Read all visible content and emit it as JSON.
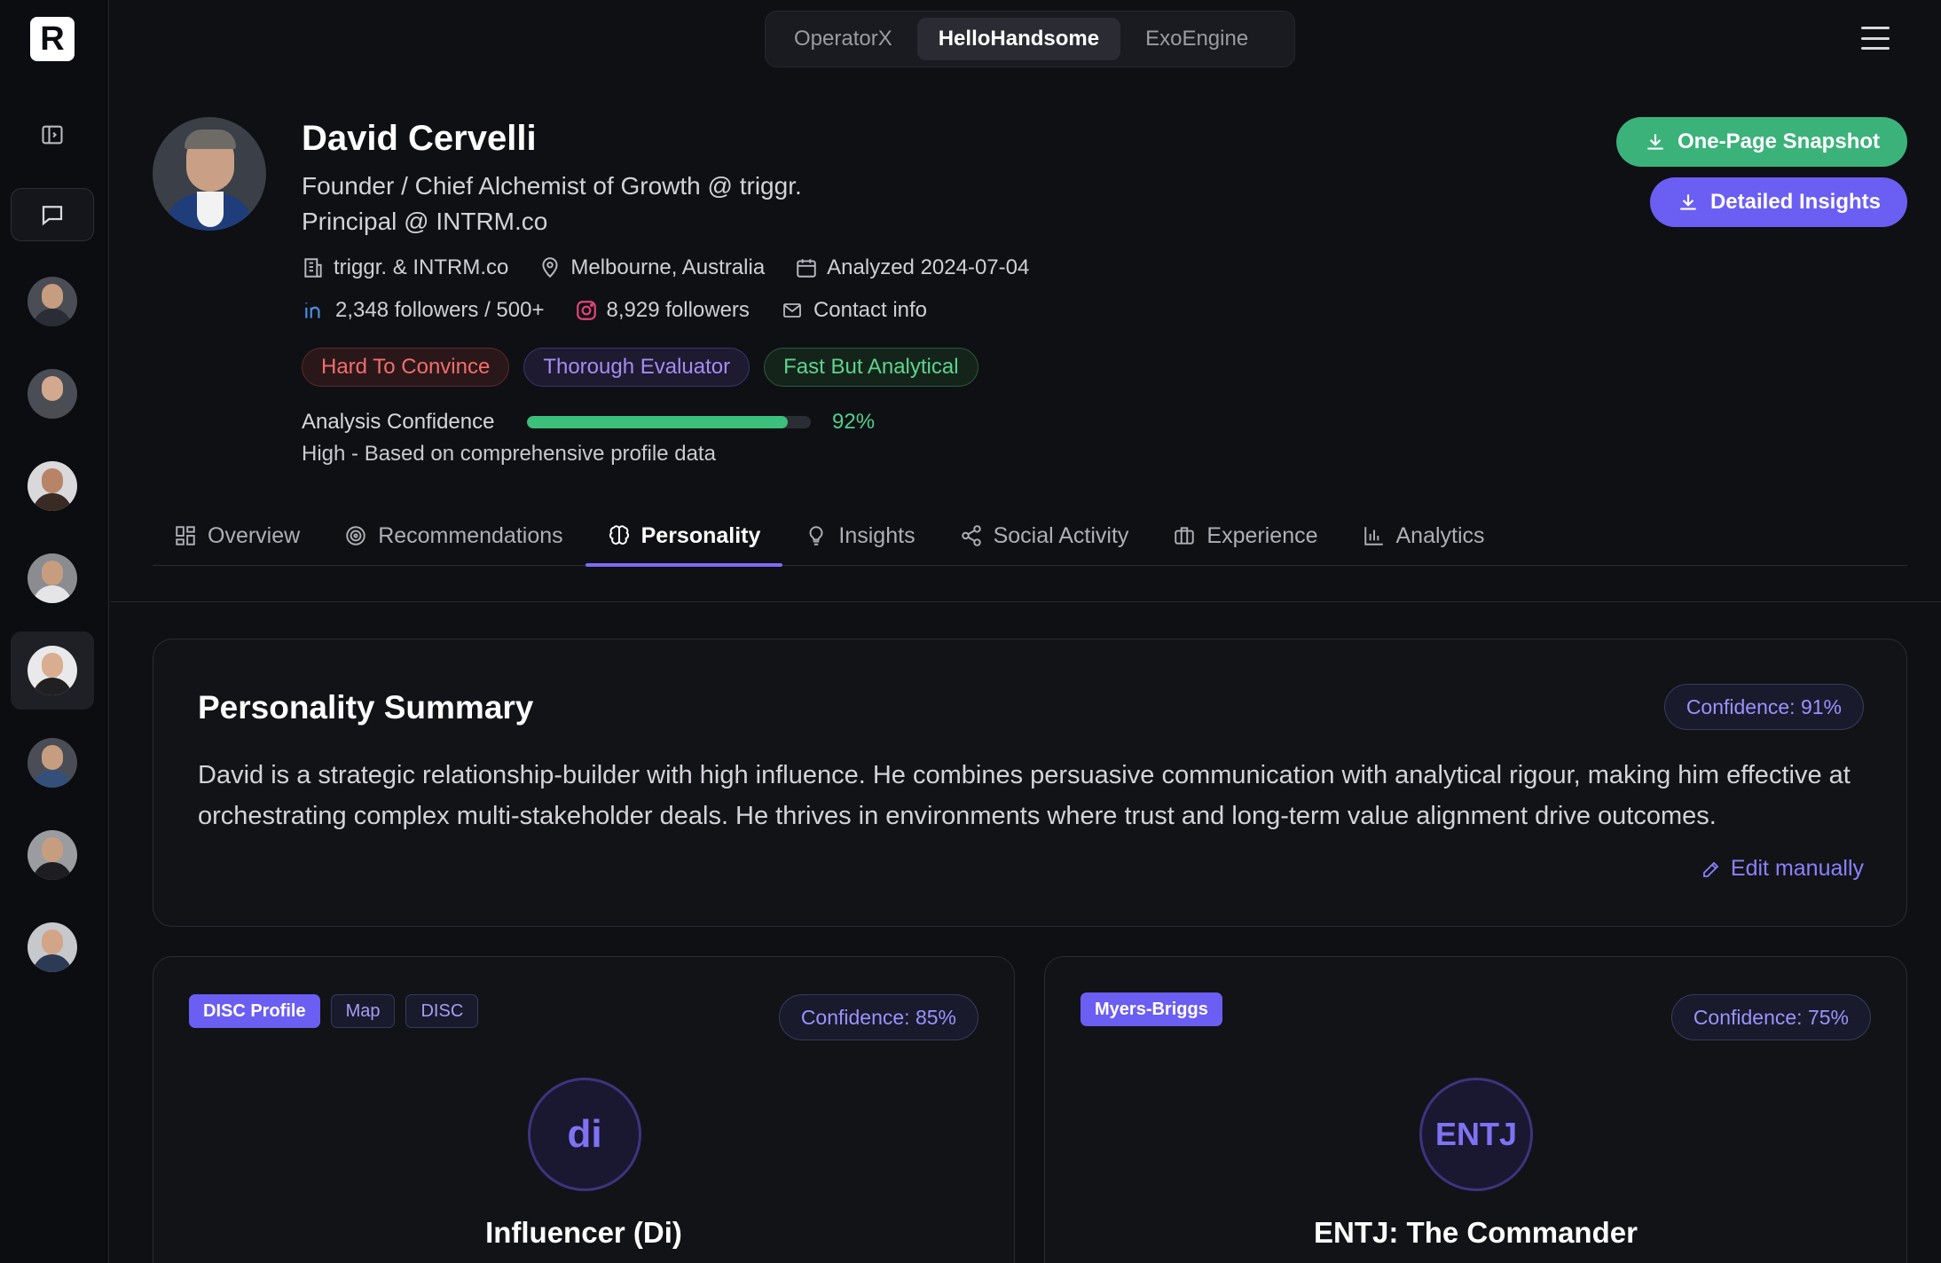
{
  "app": {
    "logo_letter": "R"
  },
  "workspace_switcher": {
    "items": [
      "OperatorX",
      "HelloHandsome",
      "ExoEngine"
    ],
    "active": "HelloHandsome"
  },
  "profile": {
    "name": "David Cervelli",
    "headline_1": "Founder / Chief Alchemist of Growth @ triggr.",
    "headline_2": "Principal @ INTRM.co",
    "company": "triggr. & INTRM.co",
    "location": "Melbourne, Australia",
    "analyzed": "Analyzed 2024-07-04",
    "linkedin": "2,348 followers / 500+",
    "instagram": "8,929 followers",
    "contact": "Contact info"
  },
  "badges": [
    "Hard To Convince",
    "Thorough Evaluator",
    "Fast But Analytical"
  ],
  "analysis": {
    "label": "Analysis Confidence",
    "value_text": "92%",
    "value": 0.92,
    "subtext": "High - Based on comprehensive profile data"
  },
  "actions": {
    "snapshot": "One-Page Snapshot",
    "detailed": "Detailed Insights"
  },
  "tabs": [
    "Overview",
    "Recommendations",
    "Personality",
    "Insights",
    "Social Activity",
    "Experience",
    "Analytics"
  ],
  "active_tab": "Personality",
  "summary": {
    "title": "Personality Summary",
    "confidence": "Confidence: 91%",
    "text": "David is a strategic relationship-builder with high influence. He combines persuasive communication with analytical rigour, making him effective at orchestrating complex multi-stakeholder deals. He thrives in environments where trust and long-term value alignment drive outcomes.",
    "edit": "Edit manually"
  },
  "disc": {
    "tags": [
      "DISC Profile",
      "Map",
      "DISC"
    ],
    "confidence": "Confidence: 85%",
    "code": "di",
    "title": "Influencer (Di)"
  },
  "mbti": {
    "tag": "Myers-Briggs",
    "confidence": "Confidence: 75%",
    "code": "ENTJ",
    "title": "ENTJ: The Commander"
  },
  "colors": {
    "accent": "#6b5ef2",
    "green": "#3bb27a",
    "red": "#f26d6d",
    "background": "#0f1014"
  }
}
